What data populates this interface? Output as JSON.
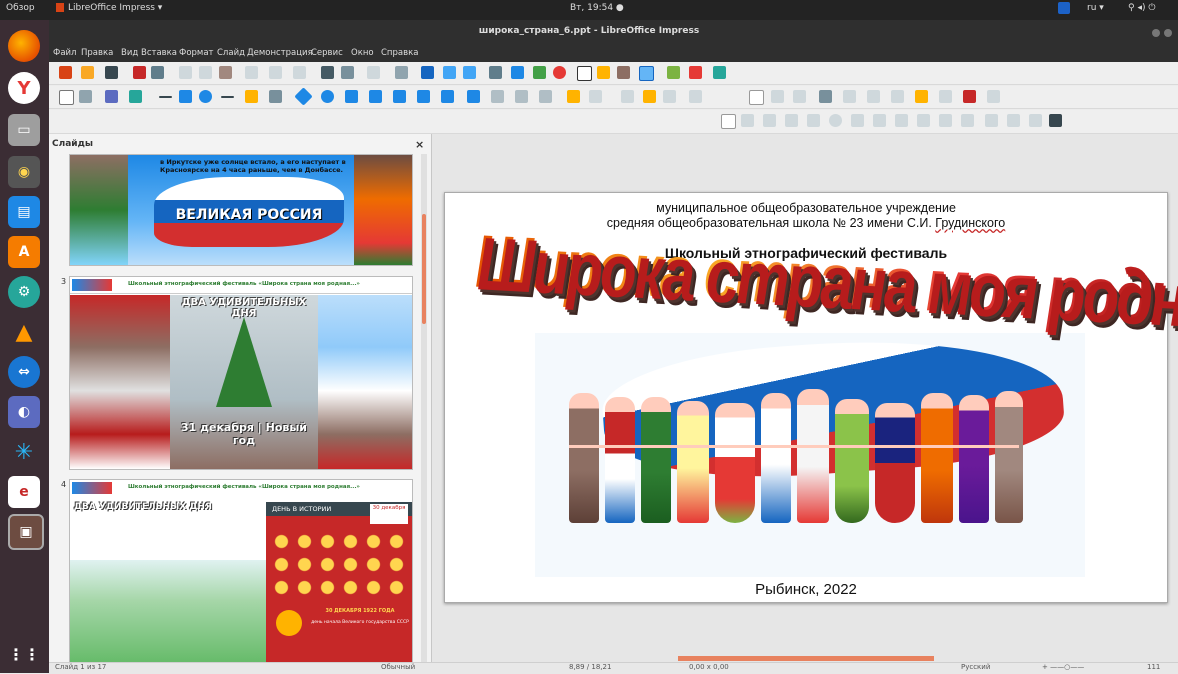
{
  "topbar": {
    "activities": "Обзор",
    "app": "LibreOffice Impress ▾",
    "clock": "Вт, 19:54 ●",
    "lang": "ru ▾"
  },
  "window": {
    "title": "широка_страна_6.ppt - LibreOffice Impress"
  },
  "menu": [
    "Файл",
    "Правка",
    "Вид",
    "Вставка",
    "Формат",
    "Слайд",
    "Демонстрация",
    "Сервис",
    "Окно",
    "Справка"
  ],
  "slides_panel": {
    "title": "Слайды",
    "close": "×",
    "slide2": {
      "top_text": "в Иркутске уже солнце встало, а его наступает в Красноярске на 4 часа раньше, чем в Донбассе.",
      "banner": "ВЕЛИКАЯ РОССИЯ"
    },
    "slide3": {
      "number": "3",
      "header": "Школьный этнографический фестиваль «Широка страна моя родная...»",
      "title": "ДВА УДИВИТЕЛЬНЫХ ДНЯ",
      "date_text": "31 декабря | Новый год"
    },
    "slide4": {
      "number": "4",
      "header": "Школьный этнографический фестиваль «Широка страна моя родная...»",
      "title": "ДВА УДИВИТЕЛЬНЫХ ДНЯ",
      "history": "ДЕНЬ В ИСТОРИИ",
      "date_badge": "30 декабря",
      "ussr_text": "30 ДЕКАБРЯ 1922 ГОДА",
      "ussr_sub": "день начала Великого государства СССР"
    }
  },
  "main_slide": {
    "line1": "муниципальное общеобразовательное учреждение",
    "line2_prefix": "средняя общеобразовательная школа № 23 имени С.И. ",
    "line2_name": "Грудинского",
    "festival": "Школьный этнографический фестиваль",
    "big_title": "Широка страна моя родная...",
    "footer": "Рыбинск, 2022"
  },
  "status": {
    "slide_count": "Слайд 1 из 17",
    "layout": "Обычный",
    "position": "8,89 / 18,21",
    "size": "0,00 x 0,00",
    "language": "Русский",
    "zoom": "111"
  }
}
